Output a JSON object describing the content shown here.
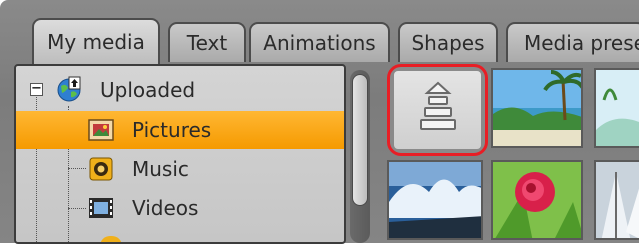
{
  "tabs": [
    {
      "label": "My media",
      "active": true
    },
    {
      "label": "Text",
      "active": false
    },
    {
      "label": "Animations",
      "active": false
    },
    {
      "label": "Shapes",
      "active": false
    },
    {
      "label": "Media prese",
      "active": false
    }
  ],
  "tree": {
    "root": {
      "label": "Uploaded",
      "icon": "globe-upload-icon",
      "expander": "−"
    },
    "children": [
      {
        "label": "Pictures",
        "icon": "picture-icon",
        "selected": true
      },
      {
        "label": "Music",
        "icon": "music-speaker-icon",
        "selected": false
      },
      {
        "label": "Videos",
        "icon": "film-strip-icon",
        "selected": false
      }
    ]
  },
  "gallery": {
    "upload_tile": {
      "icon": "upload-stack-icon",
      "highlight_color": "#e81e25"
    },
    "thumbnails": [
      "palm-beach-thumbnail",
      "coast-thumbnail",
      "ocean-wave-thumbnail",
      "pink-flower-thumbnail",
      "snow-tree-thumbnail"
    ]
  },
  "colors": {
    "selection": "#f7a614",
    "panel": "#c8c8c8",
    "frame": "#808080"
  }
}
